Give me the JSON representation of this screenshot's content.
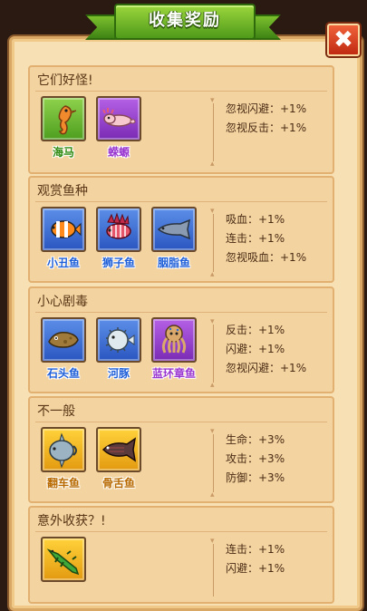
{
  "title": "收集奖励",
  "close_symbol": "✖",
  "sections": [
    {
      "header": "它们好怪!",
      "items": [
        {
          "name": "海马",
          "rarity": "green",
          "icon": "seahorse-icon"
        },
        {
          "name": "蝾螈",
          "rarity": "purple",
          "icon": "axolotl-icon"
        }
      ],
      "stats": [
        "忽视闪避：+1%",
        "忽视反击：+1%"
      ]
    },
    {
      "header": "观赏鱼种",
      "items": [
        {
          "name": "小丑鱼",
          "rarity": "blue",
          "icon": "clownfish-icon"
        },
        {
          "name": "狮子鱼",
          "rarity": "blue",
          "icon": "lionfish-icon"
        },
        {
          "name": "胭脂鱼",
          "rarity": "blue",
          "icon": "sucker-fish-icon"
        }
      ],
      "stats": [
        "吸血：+1%",
        "连击：+1%",
        "忽视吸血：+1%"
      ]
    },
    {
      "header": "小心剧毒",
      "items": [
        {
          "name": "石头鱼",
          "rarity": "blue",
          "icon": "stonefish-icon"
        },
        {
          "name": "河豚",
          "rarity": "blue",
          "icon": "pufferfish-icon"
        },
        {
          "name": "蓝环章鱼",
          "rarity": "purple",
          "icon": "octopus-icon"
        }
      ],
      "stats": [
        "反击：+1%",
        "闪避：+1%",
        "忽视闪避：+1%"
      ]
    },
    {
      "header": "不一般",
      "items": [
        {
          "name": "翻车鱼",
          "rarity": "gold",
          "icon": "sunfish-icon"
        },
        {
          "name": "骨舌鱼",
          "rarity": "gold",
          "icon": "arowana-icon"
        }
      ],
      "stats": [
        "生命：+3%",
        "攻击：+3%",
        "防御：+3%"
      ]
    },
    {
      "header": "意外收获？!",
      "items": [
        {
          "name": "",
          "rarity": "gold",
          "icon": "crocodile-icon"
        }
      ],
      "stats": [
        "连击：+1%",
        "闪避：+1%"
      ]
    }
  ],
  "colors": {
    "green_tile": "#6ab832",
    "purple_tile": "#9a44d0",
    "blue_tile": "#3f72d8",
    "gold_tile": "#f2b524",
    "panel_bg": "#f7e0b4",
    "ribbon_green": "#6fba2a",
    "close_red": "#d9401f"
  }
}
